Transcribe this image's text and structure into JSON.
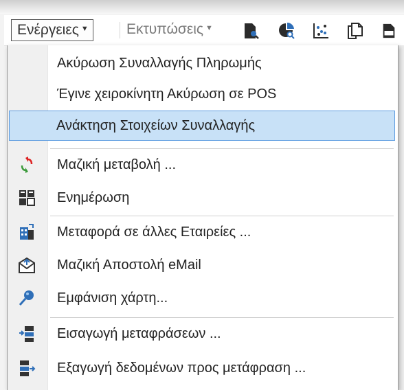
{
  "toolbar": {
    "actions_label": "Ενέργειες",
    "prints_label": "Εκτυπώσεις",
    "icons": [
      "document-search-icon",
      "chart-search-icon",
      "scatter-chart-icon",
      "copy-document-icon",
      "csv-file-icon"
    ]
  },
  "menu": {
    "items": [
      {
        "label": "Ακύρωση Συναλλαγής Πληρωμής",
        "icon": ""
      },
      {
        "label": "Έγινε χειροκίνητη Ακύρωση σε POS",
        "icon": ""
      },
      {
        "label": "Ανάκτηση Στοιχείων Συναλλαγής",
        "icon": "",
        "selected": true
      },
      {
        "label": "Μαζική μεταβολή ...",
        "icon": "bulk-change-icon"
      },
      {
        "label": "Ενημέρωση",
        "icon": "update-icon"
      },
      {
        "label": "Μεταφορά σε άλλες Εταιρείες ...",
        "icon": "transfer-company-icon"
      },
      {
        "label": "Μαζική Αποστολή eMail",
        "icon": "mass-email-icon"
      },
      {
        "label": "Εμφάνιση χάρτη...",
        "icon": "map-pin-icon"
      },
      {
        "label": "Εισαγωγή μεταφράσεων ...",
        "icon": "import-translations-icon"
      },
      {
        "label": "Εξαγωγή δεδομένων προς μετάφραση ...",
        "icon": "export-translation-icon"
      }
    ]
  },
  "colors": {
    "selection_bg": "#c8e1f7",
    "selection_border": "#5c9be0",
    "icon_blue": "#2f6fb8",
    "icon_dark": "#333333"
  }
}
